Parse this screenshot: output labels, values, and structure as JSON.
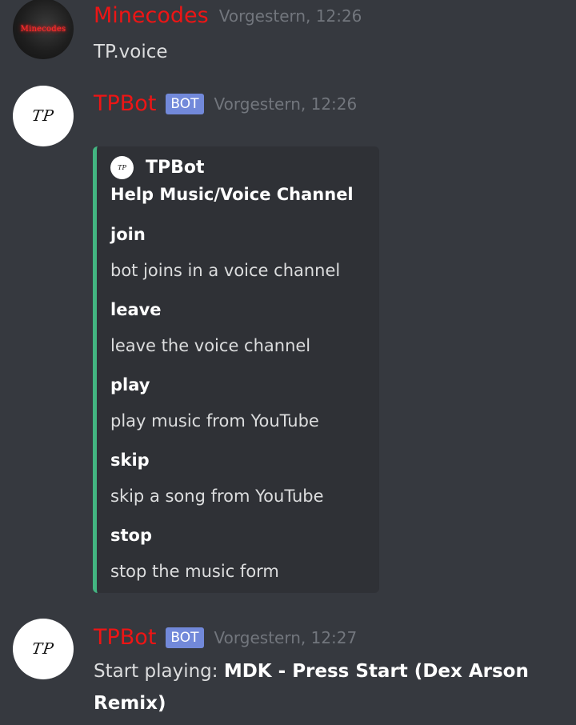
{
  "messages": [
    {
      "author": "Minecodes",
      "avatar_text": "Minecodes",
      "timestamp": "Vorgestern, 12:26",
      "text": "TP.voice"
    },
    {
      "author": "TPBot",
      "avatar_text": "TP",
      "badge": "BOT",
      "timestamp": "Vorgestern, 12:26",
      "embed": {
        "accent_color": "#43b581",
        "author_icon_text": "TP",
        "author_name": "TPBot",
        "title": "Help Music/Voice Channel",
        "fields": [
          {
            "name": "join",
            "value": "bot joins in a voice channel"
          },
          {
            "name": "leave",
            "value": "leave the voice channel"
          },
          {
            "name": "play",
            "value": "play music from YouTube"
          },
          {
            "name": "skip",
            "value": "skip a song from YouTube"
          },
          {
            "name": "stop",
            "value": "stop the music form"
          }
        ]
      }
    },
    {
      "author": "TPBot",
      "avatar_text": "TP",
      "badge": "BOT",
      "timestamp": "Vorgestern, 12:27",
      "text_prefix": "Start playing: ",
      "text_bold_line1": "MDK - Press Start (Dex Arson",
      "text_bold_line2": "Remix)"
    }
  ],
  "colors": {
    "background": "#36393f",
    "username": "#ed1515",
    "bot_badge": "#7289da",
    "timestamp": "#72767d",
    "embed_background": "#2f3136"
  }
}
